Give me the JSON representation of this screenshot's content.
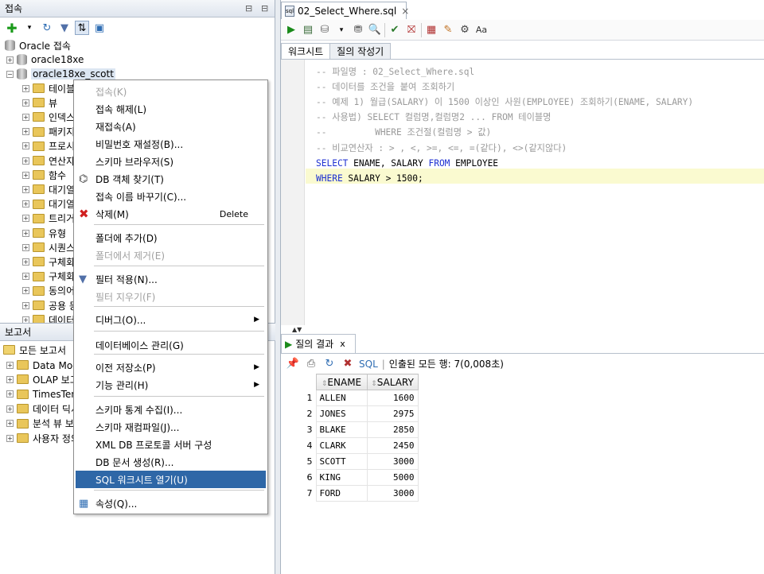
{
  "connections_panel": {
    "title": "접속",
    "root_label": "Oracle 접속",
    "items": [
      {
        "label": "oracle18xe"
      },
      {
        "label": "oracle18xe_scott"
      }
    ],
    "children": [
      "테이블",
      "뷰",
      "인덱스",
      "패키지",
      "프로시저",
      "연산자",
      "함수",
      "대기열",
      "대기열 테이블",
      "트리거",
      "유형",
      "시퀀스",
      "구체화된 뷰",
      "구체화된 뷰 로그",
      "동의어",
      "공용 동의어",
      "데이터베이스 링크"
    ]
  },
  "reports_panel": {
    "title": "보고서",
    "root_label": "모든 보고서",
    "items": [
      "Data Modeler 보고서",
      "OLAP 보고서",
      "TimesTen 보고서",
      "데이터 딕셔너리 보고서",
      "분석 뷰 보고서",
      "사용자 정의 보고서"
    ]
  },
  "context_menu": {
    "items": [
      {
        "label": "접속(K)",
        "disabled": true
      },
      {
        "label": "접속 해제(L)"
      },
      {
        "label": "재접속(A)"
      },
      {
        "label": "비밀번호 재설정(B)..."
      },
      {
        "label": "스키마 브라우저(S)"
      },
      {
        "label": "DB 객체 찾기(T)",
        "icon": "binoculars-icon"
      },
      {
        "label": "접속 이름 바꾸기(C)..."
      },
      {
        "label": "삭제(M)",
        "accel": "Delete",
        "icon": "delete-x-icon"
      },
      {
        "label": "폴더에 추가(D)"
      },
      {
        "label": "폴더에서 제거(E)",
        "disabled": true
      },
      {
        "label": "필터 적용(N)...",
        "icon": "filter-icon"
      },
      {
        "label": "필터 지우기(F)",
        "disabled": true
      },
      {
        "label": "디버그(O)...",
        "submenu": true
      },
      {
        "label": "데이터베이스 관리(G)"
      },
      {
        "label": "이전 저장소(P)",
        "submenu": true
      },
      {
        "label": "기능 관리(H)",
        "submenu": true
      },
      {
        "label": "스키마 통계 수집(I)..."
      },
      {
        "label": "스키마 재컴파일(J)..."
      },
      {
        "label": "XML DB 프로토콜 서버 구성"
      },
      {
        "label": "DB 문서 생성(R)..."
      },
      {
        "label": "SQL 워크시트 열기(U)",
        "selected": true
      },
      {
        "label": "속성(Q)...",
        "icon": "properties-icon"
      }
    ]
  },
  "editor": {
    "tab_title": "02_Select_Where.sql",
    "subtabs": [
      "워크시트",
      "질의 작성기"
    ],
    "lines": [
      "-- 파일명 : 02_Select_Where.sql",
      "-- 데이터를 조건을 붙여 조회하기",
      "-- 예제 1) 월급(SALARY) 이 1500 이상인 사원(EMPLOYEE) 조회하기(ENAME, SALARY)",
      "-- 사용법) SELECT 컬럼명,컬럼명2 ... FROM 테이블명",
      "--         WHERE 조건절(컬럼명 > 값)",
      "-- 비교연산자 : > , <, >=, <=, =(같다), <>(같지않다)"
    ],
    "sql_line1": {
      "kw1": "SELECT",
      "mid": " ENAME, SALARY ",
      "kw2": "FROM",
      "rest": " EMPLOYEE"
    },
    "sql_line2": {
      "kw1": "WHERE",
      "rest": " SALARY > 1500;"
    }
  },
  "results": {
    "tab_title": "질의 결과",
    "close": "x",
    "sql_label": "SQL",
    "status": "인출된 모든 행: 7(0,008초)",
    "columns": [
      "ENAME",
      "SALARY"
    ],
    "rows": [
      [
        "1",
        "ALLEN",
        "1600"
      ],
      [
        "2",
        "JONES",
        "2975"
      ],
      [
        "3",
        "BLAKE",
        "2850"
      ],
      [
        "4",
        "CLARK",
        "2450"
      ],
      [
        "5",
        "SCOTT",
        "3000"
      ],
      [
        "6",
        "KING",
        "5000"
      ],
      [
        "7",
        "FORD",
        "3000"
      ]
    ]
  }
}
